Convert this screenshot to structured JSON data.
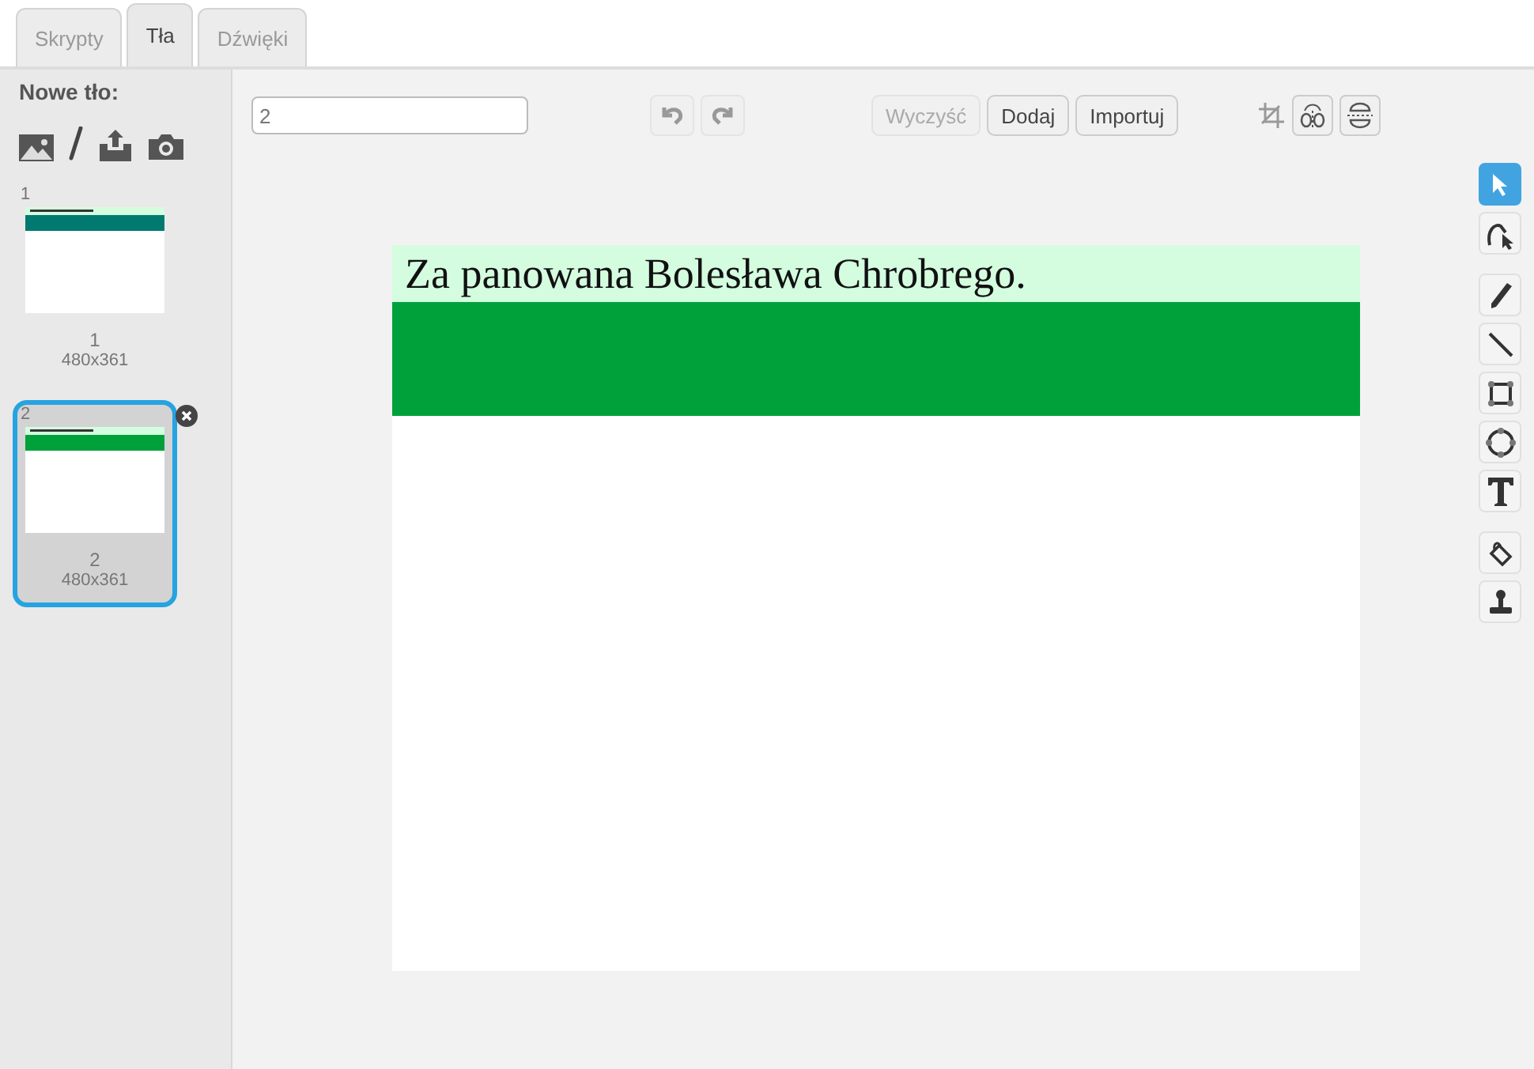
{
  "tabs": [
    {
      "label": "Skrypty",
      "selected": false
    },
    {
      "label": "Tła",
      "selected": true
    },
    {
      "label": "Dźwięki",
      "selected": false
    }
  ],
  "new_backdrop": {
    "label": "Nowe tło:"
  },
  "backdrops": [
    {
      "number": "1",
      "name": "1",
      "size": "480x361",
      "selected": false,
      "color": "#007a70"
    },
    {
      "number": "2",
      "name": "2",
      "size": "480x361",
      "selected": true,
      "color": "#00a13b"
    }
  ],
  "editor": {
    "name_value": "2",
    "buttons": [
      {
        "label": "Wyczyść",
        "disabled": true
      },
      {
        "label": "Dodaj",
        "disabled": false
      },
      {
        "label": "Importuj",
        "disabled": false
      }
    ],
    "tools": [
      {
        "kind": "select",
        "selected": true
      },
      {
        "kind": "reshape",
        "selected": false
      },
      {
        "kind": "pencil",
        "selected": false
      },
      {
        "kind": "line",
        "selected": false
      },
      {
        "kind": "rectangle",
        "selected": false
      },
      {
        "kind": "ellipse",
        "selected": false
      },
      {
        "kind": "text",
        "selected": false
      },
      {
        "kind": "fill",
        "selected": false
      },
      {
        "kind": "stamp",
        "selected": false
      }
    ],
    "canvas_text": "Za panowana Bolesława Chrobrego."
  }
}
